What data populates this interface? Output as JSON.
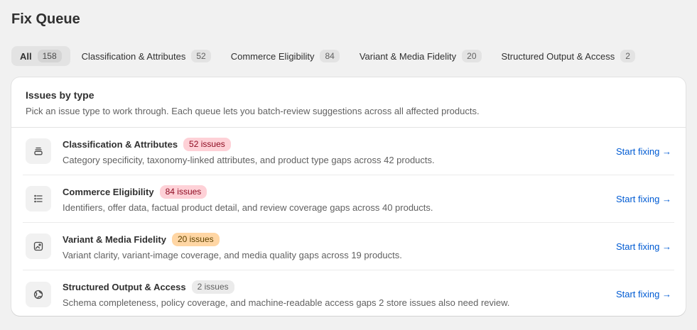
{
  "page": {
    "title": "Fix Queue"
  },
  "tabs": [
    {
      "label": "All",
      "count": "158"
    },
    {
      "label": "Classification & Attributes",
      "count": "52"
    },
    {
      "label": "Commerce Eligibility",
      "count": "84"
    },
    {
      "label": "Variant & Media Fidelity",
      "count": "20"
    },
    {
      "label": "Structured Output & Access",
      "count": "2"
    }
  ],
  "card": {
    "title": "Issues by type",
    "subtitle": "Pick an issue type to work through. Each queue lets you batch-review suggestions across all affected products."
  },
  "issues": [
    {
      "title": "Classification & Attributes",
      "badge": "52 issues",
      "description": "Category specificity, taxonomy-linked attributes, and product type gaps across 42 products.",
      "action": "Start fixing →",
      "icon": "stack-icon"
    },
    {
      "title": "Commerce Eligibility",
      "badge": "84 issues",
      "description": "Identifiers, offer data, factual product detail, and review coverage gaps across 40 products.",
      "action": "Start fixing →",
      "icon": "list-icon"
    },
    {
      "title": "Variant & Media Fidelity",
      "badge": "20 issues",
      "description": "Variant clarity, variant-image coverage, and media quality gaps across 19 products.",
      "action": "Start fixing →",
      "icon": "image-icon"
    },
    {
      "title": "Structured Output & Access",
      "badge": "2 issues",
      "description": "Schema completeness, policy coverage, and machine-readable access gaps 2 store issues also need review.",
      "action": "Start fixing →",
      "icon": "globe-icon"
    }
  ],
  "colors": {
    "link": "#005bd3",
    "critical_badge_bg": "#fed1d7",
    "warning_badge_bg": "#ffd6a4",
    "neutral_badge_bg": "#ebebeb"
  }
}
